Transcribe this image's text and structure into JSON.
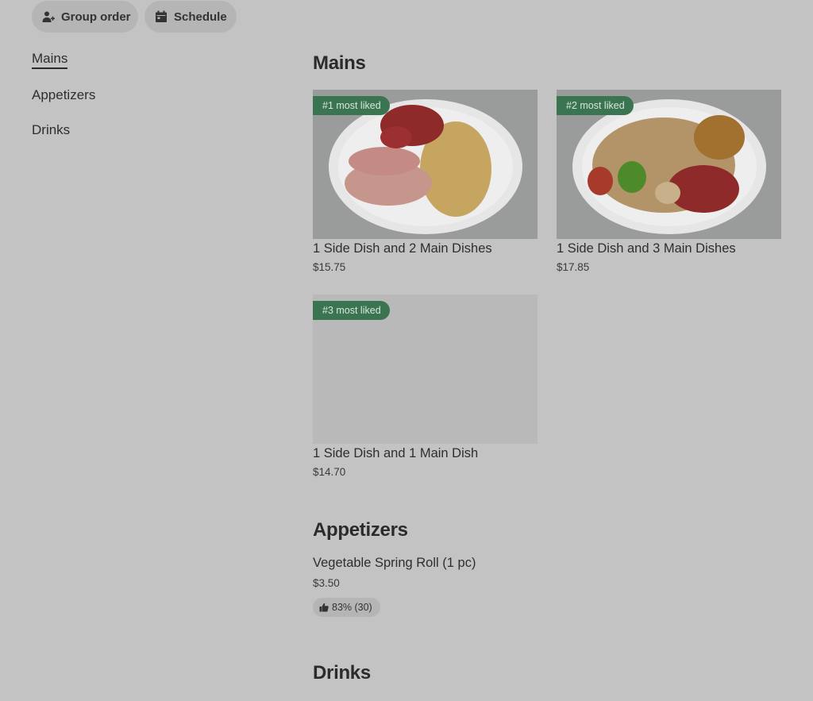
{
  "toolbar": {
    "group_order_label": "Group order",
    "schedule_label": "Schedule"
  },
  "sidebar": {
    "items": [
      {
        "label": "Mains",
        "active": true
      },
      {
        "label": "Appetizers",
        "active": false
      },
      {
        "label": "Drinks",
        "active": false
      }
    ]
  },
  "sections": {
    "mains": {
      "title": "Mains",
      "items": [
        {
          "badge": "#1 most liked",
          "name": "1 Side Dish and 2 Main Dishes",
          "price": "$15.75"
        },
        {
          "badge": "#2 most liked",
          "name": "1 Side Dish and 3 Main Dishes",
          "price": "$17.85"
        },
        {
          "badge": "#3 most liked",
          "name": "1 Side Dish and 1 Main Dish",
          "price": "$14.70"
        }
      ]
    },
    "appetizers": {
      "title": "Appetizers",
      "items": [
        {
          "name": "Vegetable Spring Roll (1 pc)",
          "price": "$3.50",
          "rating": "83% (30)"
        }
      ]
    },
    "drinks": {
      "title": "Drinks"
    }
  },
  "colors": {
    "overlay_background": "#c3c3c3",
    "badge_green": "#3a7451"
  }
}
